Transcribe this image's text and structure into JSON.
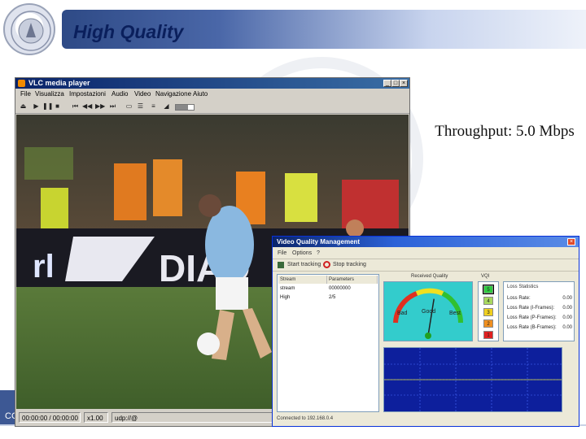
{
  "slide": {
    "title": "High Quality",
    "throughput_text": "Throughput: 5.0 Mbps",
    "footer_left": "CC"
  },
  "vlc": {
    "title": "VLC media player",
    "menu": [
      "File",
      "Visualizza",
      "Impostazioni",
      "Audio",
      "Video",
      "Navigazione",
      "Aiuto"
    ],
    "status": {
      "time": "00:00:00 / 00:00:00",
      "speed": "x1.00",
      "stream": "udp://@"
    },
    "seek_fraction": 0.7
  },
  "vqm": {
    "title": "Video Quality Management",
    "menu": [
      "File",
      "Options",
      "?"
    ],
    "toolbar": {
      "start": "Start tracking",
      "stop": "Stop tracking"
    },
    "table": {
      "headers": [
        "Stream",
        "Parameters"
      ],
      "rows": [
        [
          "stream",
          "00000000"
        ],
        [
          "High",
          "2/5"
        ]
      ]
    },
    "gauge": {
      "label": "Received Quality",
      "labels": [
        "Bad",
        "Good",
        "Best"
      ],
      "needle_fraction": 0.55
    },
    "vqi": {
      "label": "VQI",
      "levels": [
        {
          "value": "5",
          "color": "#2ecc40"
        },
        {
          "value": "4",
          "color": "#a8d860"
        },
        {
          "value": "3",
          "color": "#f0d020"
        },
        {
          "value": "2",
          "color": "#f09020"
        },
        {
          "value": "1",
          "color": "#e02020"
        }
      ],
      "active_value": "5"
    },
    "lost": {
      "heading": "Loss Statistics",
      "rows": [
        {
          "label": "Loss Rate:",
          "value": "0.00"
        },
        {
          "label": "Loss Rate (I-Frames):",
          "value": "0.00"
        },
        {
          "label": "Loss Rate (P-Frames):",
          "value": "0.00"
        },
        {
          "label": "Loss Rate (B-Frames):",
          "value": "0.00"
        }
      ]
    },
    "status": "Connected to 192.168.0.4"
  }
}
